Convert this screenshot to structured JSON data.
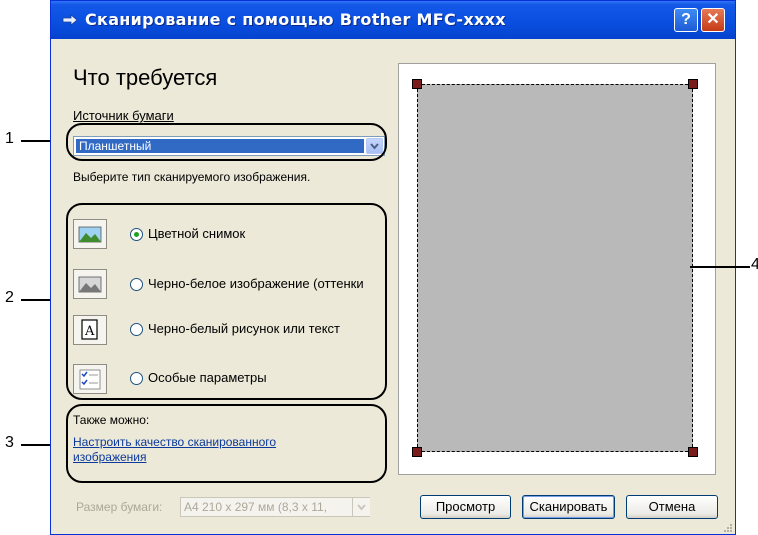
{
  "window": {
    "title": "Сканирование с помощью Brother MFC-xxxx",
    "help_label": "?",
    "close_label": "✕"
  },
  "left_panel": {
    "heading": "Что требуется",
    "paper_source_label": "Источник бумаги",
    "paper_source_value": "Планшетный",
    "image_type_prompt": "Выберите тип сканируемого изображения.",
    "options": [
      {
        "label": "Цветной снимок",
        "selected": true,
        "icon": "color-photo-icon"
      },
      {
        "label": "Черно-белое изображение (оттенки",
        "selected": false,
        "icon": "grayscale-photo-icon"
      },
      {
        "label": "Черно-белый рисунок или текст",
        "selected": false,
        "icon": "bw-text-icon"
      },
      {
        "label": "Особые параметры",
        "selected": false,
        "icon": "custom-settings-icon"
      }
    ],
    "also_label": "Также можно:",
    "adjust_link_line1": "Настроить качество сканированного",
    "adjust_link_line2": "изображения"
  },
  "bottom": {
    "paper_size_label": "Размер бумаги:",
    "paper_size_value": "A4 210 x 297 мм (8,3 x 11,",
    "preview_button": "Просмотр",
    "scan_button": "Сканировать",
    "cancel_button": "Отмена"
  },
  "annotations": [
    "1",
    "2",
    "3",
    "4"
  ]
}
